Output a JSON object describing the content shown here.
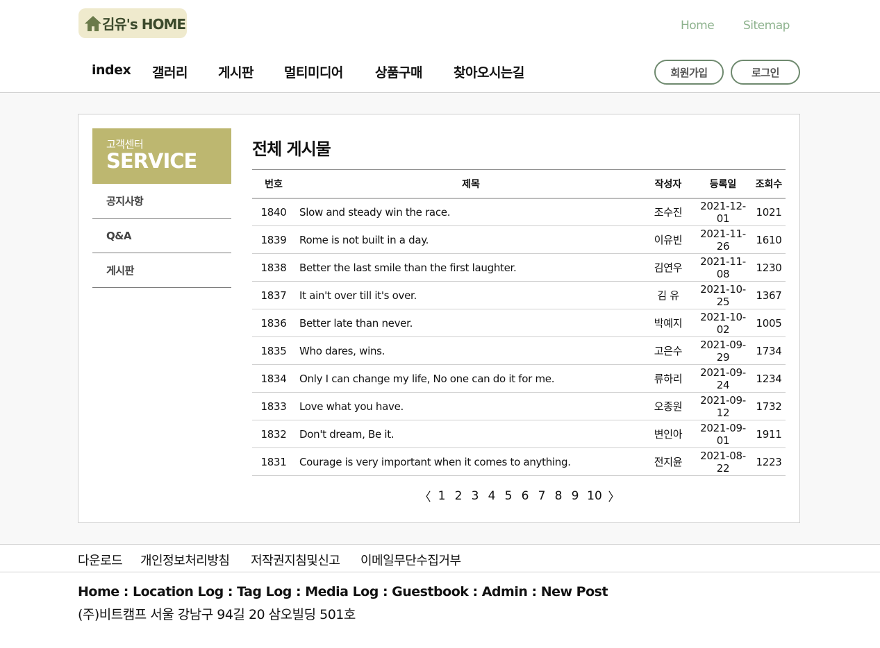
{
  "header": {
    "logo_text": "김유's HOME",
    "logo_icon": "home-icon",
    "util_links": [
      "Home",
      "Sitemap"
    ],
    "nav": [
      "index",
      "갤러리",
      "게시판",
      "멀티미디어",
      "상품구매",
      "찾아오시는길"
    ],
    "join_label": "회원가입",
    "login_label": "로그인",
    "colors": {
      "logo_bg": "#efeacd",
      "util": "#8db28d",
      "accent": "#bdb770"
    }
  },
  "sidebar": {
    "sub": "고객센터",
    "main": "SERVICE",
    "items": [
      "공지사항",
      "Q&A",
      "게시판"
    ]
  },
  "board": {
    "title": "전체 게시물",
    "columns": [
      "번호",
      "제목",
      "작성자",
      "등록일",
      "조회수"
    ],
    "rows": [
      [
        "1840",
        "Slow and steady win the race.",
        "조수진",
        "2021-12-01",
        "1021"
      ],
      [
        "1839",
        "Rome is not built in a day.",
        "이유빈",
        "2021-11-26",
        "1610"
      ],
      [
        "1838",
        "Better the last smile than the first laughter.",
        "김연우",
        "2021-11-08",
        "1230"
      ],
      [
        "1837",
        "It ain't over till it's over.",
        "김  유",
        "2021-10-25",
        "1367"
      ],
      [
        "1836",
        "Better late than never.",
        "박예지",
        "2021-10-02",
        "1005"
      ],
      [
        "1835",
        "Who dares, wins.",
        "고은수",
        "2021-09-29",
        "1734"
      ],
      [
        "1834",
        "Only I can change my life, No one can do it for me.",
        "류하리",
        "2021-09-24",
        "1234"
      ],
      [
        "1833",
        "Love what you have.",
        "오종원",
        "2021-09-12",
        "1732"
      ],
      [
        "1832",
        "Don't dream, Be it.",
        "변인아",
        "2021-09-01",
        "1911"
      ],
      [
        "1831",
        "Courage is very important when it comes to anything.",
        "전지윤",
        "2021-08-22",
        "1223"
      ]
    ]
  },
  "pagination": {
    "prev": "〈",
    "pages": [
      "1",
      "2",
      "3",
      "4",
      "5",
      "6",
      "7",
      "8",
      "9",
      "10"
    ],
    "next": "〉"
  },
  "footer": {
    "links": [
      "다운로드",
      "개인정보처리방침",
      "저작권지침및신고",
      "이메일무단수집거부"
    ],
    "nav_line": "Home : Location Log : Tag Log : Media Log : Guestbook : Admin : New Post",
    "address": "(주)비트캠프 서울 강남구 94길 20 삼오빌딩 501호"
  }
}
